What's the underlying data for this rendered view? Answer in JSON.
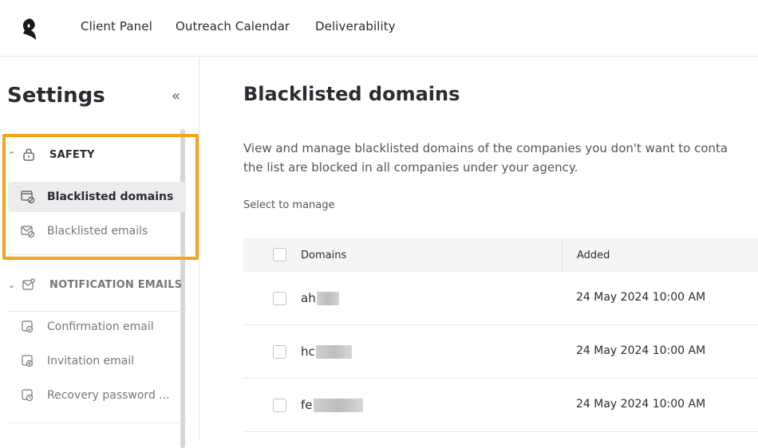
{
  "topbar": {
    "logo_icon": "bird-logo-icon",
    "nav": [
      "Client Panel",
      "Outreach Calendar",
      "Deliverability"
    ]
  },
  "sidebar": {
    "title": "Settings",
    "collapse_icon": "double-chevron-left-icon",
    "sections": [
      {
        "label": "SAFETY",
        "icon": "lock-icon",
        "expanded": true,
        "items": [
          {
            "label": "Blacklisted domains",
            "icon": "window-block-icon",
            "active": true
          },
          {
            "label": "Blacklisted emails",
            "icon": "mail-block-icon",
            "active": false
          }
        ]
      },
      {
        "label": "NOTIFICATION EMAILS",
        "icon": "mail-notification-icon",
        "expanded": true,
        "items": [
          {
            "label": "Confirmation email",
            "icon": "mail-check-icon"
          },
          {
            "label": "Invitation email",
            "icon": "mail-plus-icon"
          },
          {
            "label": "Recovery password ...",
            "icon": "mail-clock-icon"
          }
        ]
      }
    ],
    "highlight_color": "#f2a51e"
  },
  "main": {
    "title": "Blacklisted domains",
    "description_line1": "View and manage blacklisted domains of the companies you don't want to conta",
    "description_line2": "the list are blocked in all companies under your agency.",
    "select_hint": "Select to manage",
    "table": {
      "columns": [
        "Domains",
        "Added"
      ],
      "rows": [
        {
          "domain": "ah",
          "added": "24 May 2024 10:00 AM"
        },
        {
          "domain": "hc",
          "added": "24 May 2024 10:00 AM"
        },
        {
          "domain": "fe",
          "added": "24 May 2024 10:00 AM"
        }
      ]
    }
  }
}
